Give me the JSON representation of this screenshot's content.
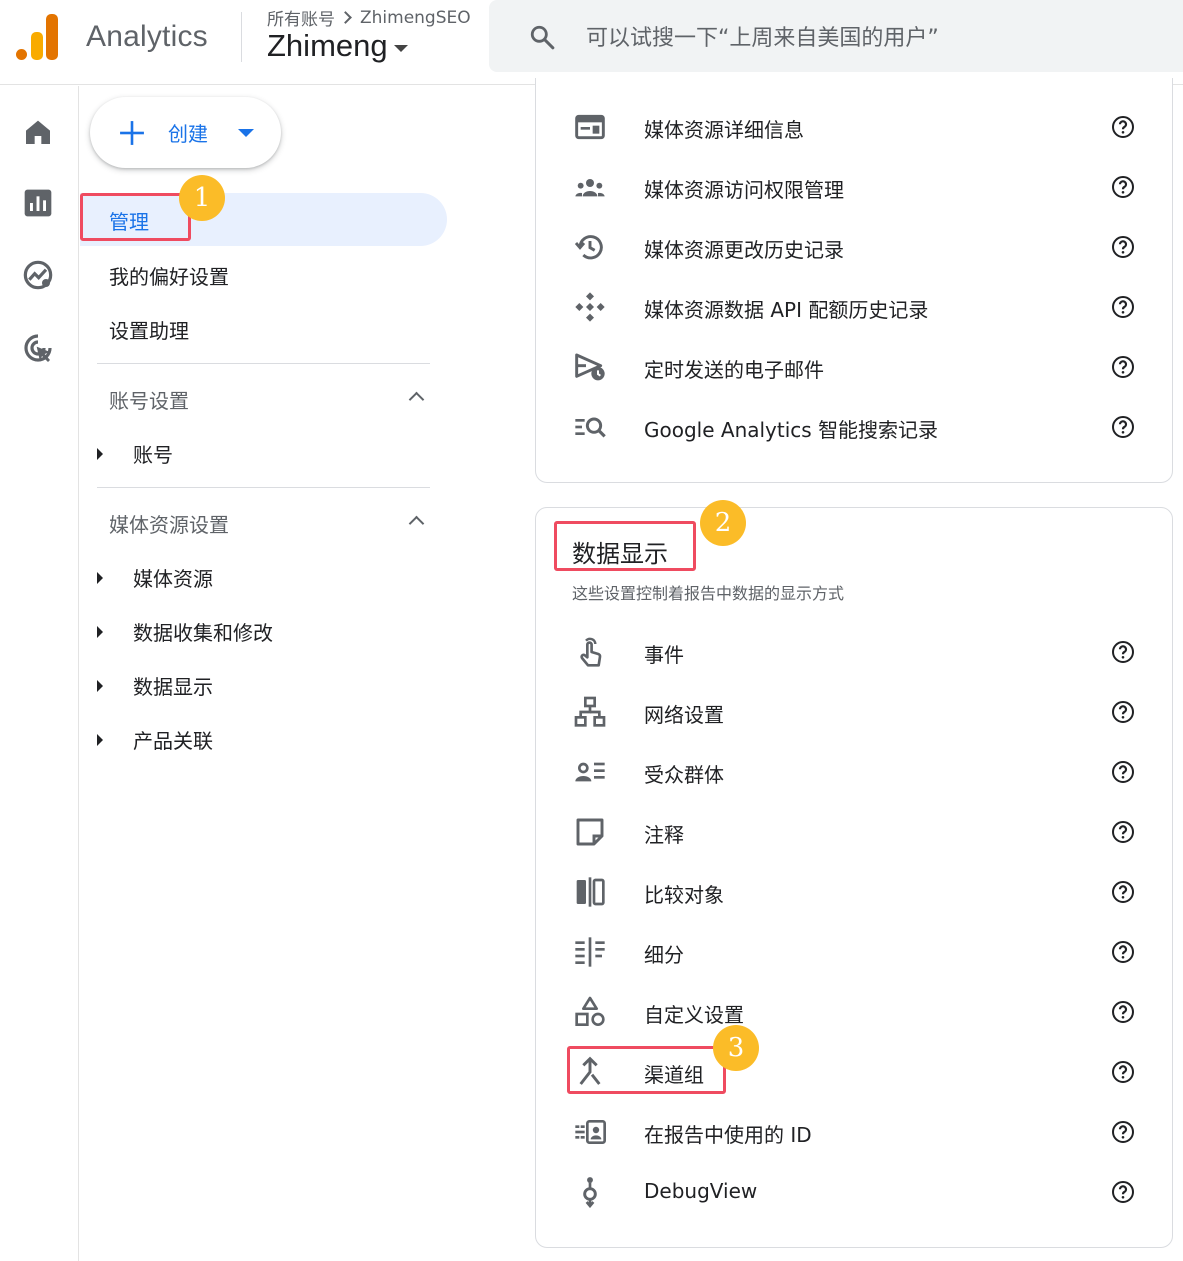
{
  "colors": {
    "accent": "#1a73e8",
    "annotation_box": "#ef4b60",
    "annotation_badge": "#fbbc28",
    "logo_orange_light": "#f9ab00",
    "logo_orange_dark": "#e37400"
  },
  "header": {
    "app_title": "Analytics",
    "breadcrumb_parent": "所有账号",
    "breadcrumb_account": "ZhimengSEO",
    "property_name": "Zhimeng",
    "search_placeholder": "可以试搜一下“上周来自美国的用户”"
  },
  "rail": {
    "icons": [
      "home-icon",
      "reports-icon",
      "explore-icon",
      "advertising-icon"
    ]
  },
  "sidebar": {
    "create_label": "创建",
    "nav": {
      "admin": "管理",
      "preferences": "我的偏好设置",
      "setup_assistant": "设置助理"
    },
    "account_section": {
      "header": "账号设置",
      "items": [
        "账号"
      ]
    },
    "property_section": {
      "header": "媒体资源设置",
      "items": [
        "媒体资源",
        "数据收集和修改",
        "数据显示",
        "产品关联"
      ]
    }
  },
  "property_card": {
    "rows": [
      {
        "label": "媒体资源详细信息",
        "icon": "property-details-icon"
      },
      {
        "label": "媒体资源访问权限管理",
        "icon": "access-management-icon"
      },
      {
        "label": "媒体资源更改历史记录",
        "icon": "history-icon"
      },
      {
        "label": "媒体资源数据 API 配额历史记录",
        "icon": "api-quota-icon"
      },
      {
        "label": "定时发送的电子邮件",
        "icon": "scheduled-email-icon"
      },
      {
        "label": "Google Analytics 智能搜索记录",
        "icon": "search-history-icon"
      }
    ]
  },
  "data_display_card": {
    "title": "数据显示",
    "subtitle": "这些设置控制着报告中数据的显示方式",
    "rows": [
      {
        "label": "事件",
        "icon": "touch-icon"
      },
      {
        "label": "网络设置",
        "icon": "network-icon"
      },
      {
        "label": "受众群体",
        "icon": "audience-icon"
      },
      {
        "label": "注释",
        "icon": "note-icon"
      },
      {
        "label": "比较对象",
        "icon": "compare-icon"
      },
      {
        "label": "细分",
        "icon": "segments-icon"
      },
      {
        "label": "自定义设置",
        "icon": "shapes-icon"
      },
      {
        "label": "渠道组",
        "icon": "merge-icon"
      },
      {
        "label": "在报告中使用的 ID",
        "icon": "reporting-id-icon"
      },
      {
        "label": "DebugView",
        "icon": "debug-icon"
      }
    ]
  },
  "annotations": [
    "1",
    "2",
    "3"
  ]
}
